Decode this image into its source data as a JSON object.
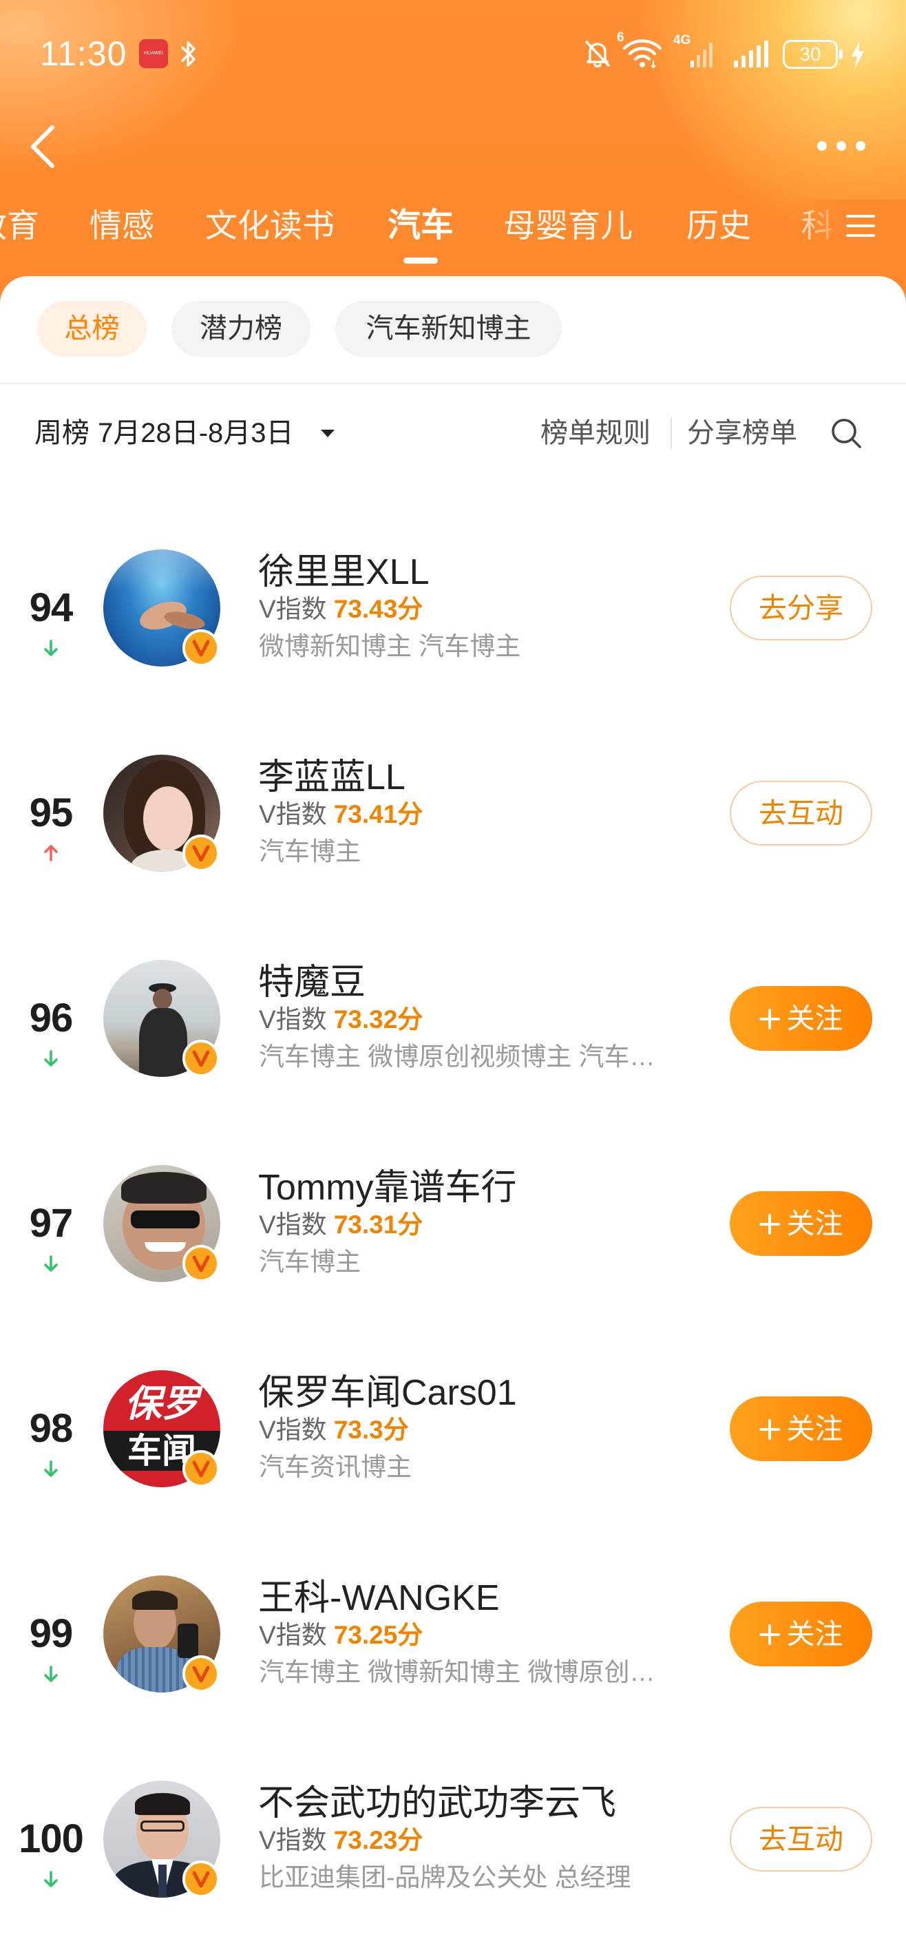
{
  "status_bar": {
    "time": "11:30",
    "app_icon": "huawei-app-icon",
    "app_icon_text": "HUAWEI",
    "bluetooth_icon": "bluetooth-icon",
    "mute_icon": "bell-mute-icon",
    "wifi_icon": "wifi-icon",
    "wifi_badge": "6",
    "network_type": "4G",
    "signal_icon": "signal-bars-icon",
    "battery_level": "30",
    "charging_icon": "charging-bolt-icon"
  },
  "header": {
    "back_icon": "chevron-left-icon",
    "more_icon": "more-dots-icon"
  },
  "category_tabs": [
    {
      "label": "教育",
      "selected": false
    },
    {
      "label": "情感",
      "selected": false
    },
    {
      "label": "文化读书",
      "selected": false
    },
    {
      "label": "汽车",
      "selected": true
    },
    {
      "label": "母婴育儿",
      "selected": false
    },
    {
      "label": "历史",
      "selected": false
    },
    {
      "label": "科",
      "selected": false
    }
  ],
  "category_menu_icon": "menu-icon",
  "sub_tabs": [
    {
      "label": "总榜",
      "selected": true
    },
    {
      "label": "潜力榜",
      "selected": false
    },
    {
      "label": "汽车新知博主",
      "selected": false
    }
  ],
  "filter": {
    "period_label": "周榜",
    "date_range": "7月28日-8月3日",
    "dropdown_icon": "caret-down-icon",
    "rules": "榜单规则",
    "share": "分享榜单",
    "search_icon": "search-icon"
  },
  "ranking": [
    {
      "rank": "94",
      "trend_icon": "arrow-down-icon",
      "name": "徐里里XLL",
      "v_label": "V指数",
      "v_score": "73.43分",
      "tags": "微博新知博主 汽车博主",
      "verified_icon": "verified-v-badge-icon",
      "action": {
        "label": "去分享",
        "filled": false
      }
    },
    {
      "rank": "95",
      "trend_icon": "arrow-up-icon",
      "name": "李蓝蓝LL",
      "v_label": "V指数",
      "v_score": "73.41分",
      "tags": "汽车博主",
      "verified_icon": "verified-v-badge-icon",
      "action": {
        "label": "去互动",
        "filled": false
      }
    },
    {
      "rank": "96",
      "trend_icon": "arrow-down-icon",
      "name": "特魔豆",
      "v_label": "V指数",
      "v_score": "73.32分",
      "tags": "汽车博主 微博原创视频博主 汽车…",
      "verified_icon": "verified-v-badge-icon",
      "action": {
        "label": "关注",
        "filled": true
      }
    },
    {
      "rank": "97",
      "trend_icon": "arrow-down-icon",
      "name": "Tommy靠谱车行",
      "v_label": "V指数",
      "v_score": "73.31分",
      "tags": "汽车博主",
      "verified_icon": "verified-v-badge-icon",
      "action": {
        "label": "关注",
        "filled": true
      }
    },
    {
      "rank": "98",
      "trend_icon": "arrow-down-icon",
      "name": "保罗车闻Cars01",
      "v_label": "V指数",
      "v_score": "73.3分",
      "tags": "汽车资讯博主",
      "verified_icon": "verified-v-badge-icon",
      "avatar_logo": {
        "top": "保罗",
        "bottom": "车闻"
      },
      "action": {
        "label": "关注",
        "filled": true
      }
    },
    {
      "rank": "99",
      "trend_icon": "arrow-down-icon",
      "name": "王科-WANGKE",
      "v_label": "V指数",
      "v_score": "73.25分",
      "tags": "汽车博主 微博新知博主 微博原创…",
      "verified_icon": "verified-v-badge-icon",
      "action": {
        "label": "关注",
        "filled": true
      }
    },
    {
      "rank": "100",
      "trend_icon": "arrow-down-icon",
      "name": "不会武功的武功李云飞",
      "v_label": "V指数",
      "v_score": "73.23分",
      "tags": "比亚迪集团-品牌及公关处 总经理",
      "verified_icon": "verified-v-badge-icon",
      "action": {
        "label": "去互动",
        "filled": false
      }
    }
  ],
  "colors": {
    "accent": "#FF8200",
    "score": "#F08300",
    "header_orange": "#FF8A2E",
    "trend_up": "#F2625B",
    "trend_down": "#35C26A",
    "verified_badge": "#FBA51C"
  }
}
